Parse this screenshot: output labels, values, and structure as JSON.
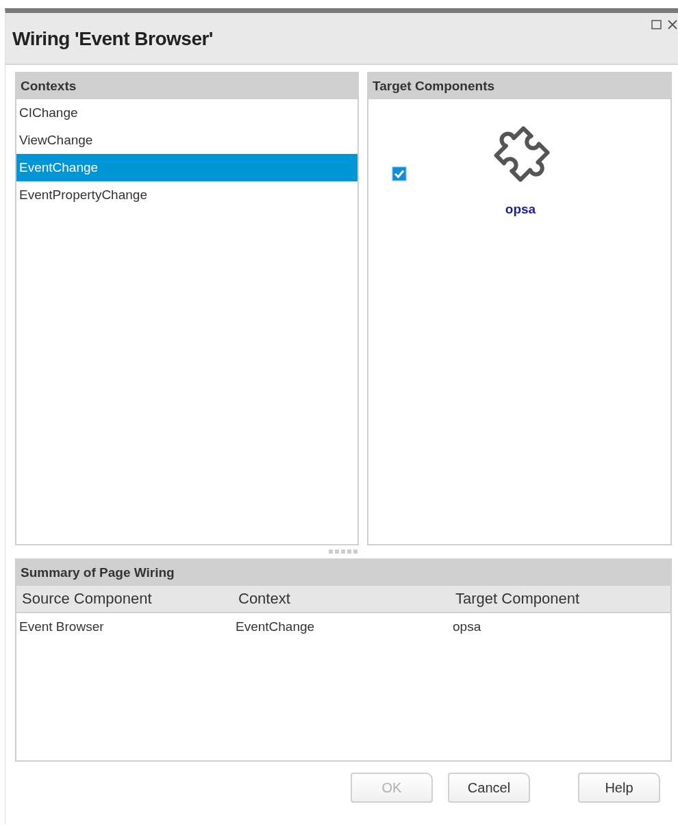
{
  "window": {
    "title": "Wiring 'Event Browser'"
  },
  "contexts": {
    "heading": "Contexts",
    "items": [
      {
        "label": "CIChange",
        "selected": false
      },
      {
        "label": "ViewChange",
        "selected": false
      },
      {
        "label": "EventChange",
        "selected": true
      },
      {
        "label": "EventPropertyChange",
        "selected": false
      }
    ]
  },
  "target_components": {
    "heading": "Target Components",
    "items": [
      {
        "name": "opsa",
        "checked": true
      }
    ]
  },
  "summary": {
    "heading": "Summary of Page Wiring",
    "columns": [
      "Source Component",
      "Context",
      "Target Component"
    ],
    "rows": [
      [
        "Event Browser",
        "EventChange",
        "opsa"
      ]
    ]
  },
  "buttons": [
    {
      "label": "OK",
      "disabled": true
    },
    {
      "label": "Cancel",
      "disabled": false
    },
    {
      "label": "Help",
      "disabled": false
    }
  ]
}
